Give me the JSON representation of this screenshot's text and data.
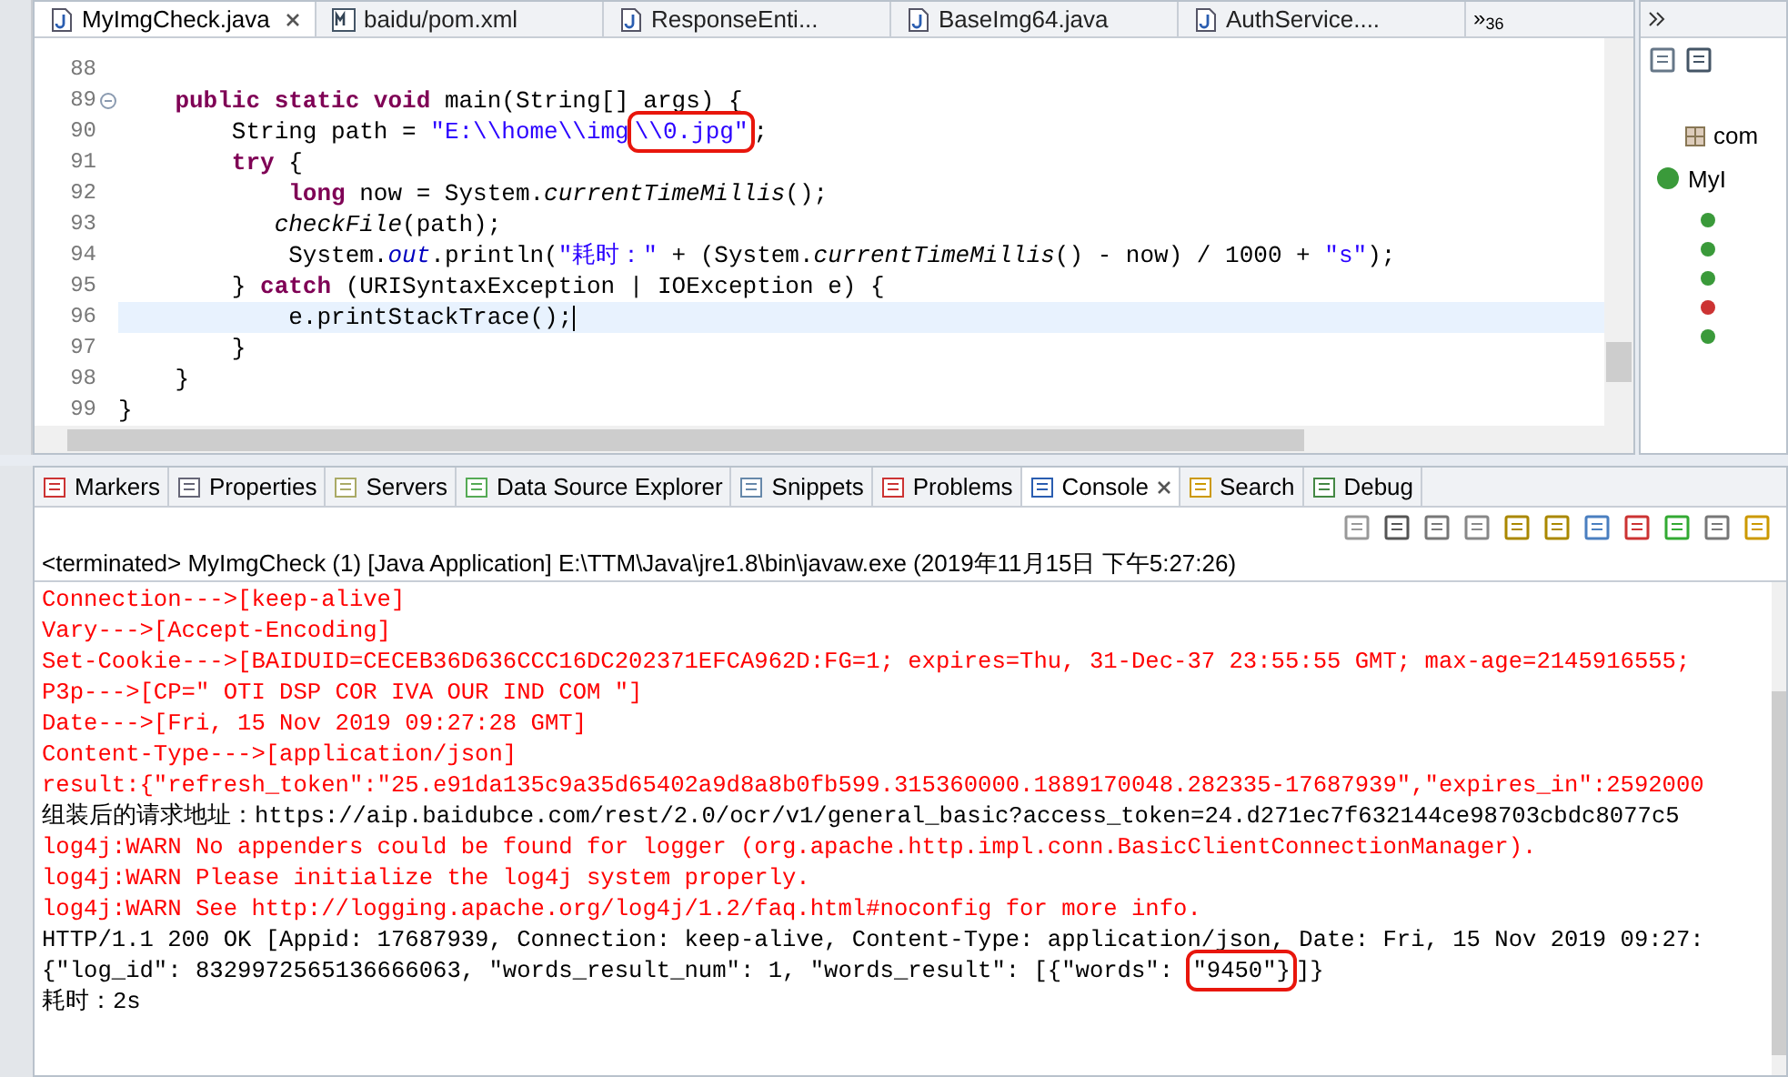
{
  "editor_tabs": [
    {
      "label": "MyImgCheck.java",
      "kind": "java",
      "selected": true
    },
    {
      "label": "baidu/pom.xml",
      "kind": "maven",
      "selected": false
    },
    {
      "label": "ResponseEnti...",
      "kind": "java",
      "selected": false
    },
    {
      "label": "BaseImg64.java",
      "kind": "java",
      "selected": false
    },
    {
      "label": "AuthService....",
      "kind": "java",
      "selected": false
    }
  ],
  "editor_overflow": {
    "symbol": "»",
    "count": "36"
  },
  "code_lines": [
    {
      "number": "88",
      "current": false,
      "folding": false
    },
    {
      "number": "89",
      "current": false,
      "folding": true,
      "segments": [
        {
          "t": "    public",
          "kind": "kw"
        },
        {
          "t": " static",
          "kind": "kw"
        },
        {
          "t": " void",
          "kind": "kw"
        },
        {
          "t": " main(String[] args) {",
          "kind": "plain"
        }
      ]
    },
    {
      "number": "90",
      "current": false,
      "folding": false,
      "segments": [
        {
          "t": "        String path = ",
          "kind": "plain"
        },
        {
          "t": "\"E:\\\\home\\\\img",
          "kind": "str"
        },
        {
          "t": "\\\\0.jpg\"",
          "kind": "str",
          "boxed": true
        },
        {
          "t": ";",
          "kind": "plain"
        }
      ]
    },
    {
      "number": "91",
      "current": false,
      "folding": false,
      "segments": [
        {
          "t": "        try",
          "kind": "kw"
        },
        {
          "t": " {",
          "kind": "plain"
        }
      ]
    },
    {
      "number": "92",
      "current": false,
      "folding": false,
      "segments": [
        {
          "t": "            long",
          "kind": "kw"
        },
        {
          "t": " now = System.",
          "kind": "plain"
        },
        {
          "t": "currentTimeMillis",
          "kind": "ital"
        },
        {
          "t": "();",
          "kind": "plain"
        }
      ]
    },
    {
      "number": "93",
      "current": false,
      "folding": false,
      "segments": [
        {
          "t": "           checkFile",
          "kind": "ital"
        },
        {
          "t": "(path);",
          "kind": "plain"
        }
      ]
    },
    {
      "number": "94",
      "current": false,
      "folding": false,
      "segments": [
        {
          "t": "            System.",
          "kind": "plain"
        },
        {
          "t": "out",
          "kind": "field"
        },
        {
          "t": ".println(",
          "kind": "plain"
        },
        {
          "t": "\"耗时：\"",
          "kind": "str"
        },
        {
          "t": " + (System.",
          "kind": "plain"
        },
        {
          "t": "currentTimeMillis",
          "kind": "ital"
        },
        {
          "t": "() - now) / 1000 + ",
          "kind": "plain"
        },
        {
          "t": "\"s\"",
          "kind": "str"
        },
        {
          "t": ");",
          "kind": "plain"
        }
      ]
    },
    {
      "number": "95",
      "current": false,
      "folding": false,
      "segments": [
        {
          "t": "        } ",
          "kind": "plain"
        },
        {
          "t": "catch",
          "kind": "kw"
        },
        {
          "t": " (URISyntaxException | IOException e) {",
          "kind": "plain"
        }
      ]
    },
    {
      "number": "96",
      "current": true,
      "folding": false,
      "segments": [
        {
          "t": "            e.printStackTrace();",
          "kind": "plain"
        }
      ]
    },
    {
      "number": "97",
      "current": false,
      "folding": false,
      "segments": [
        {
          "t": "        }",
          "kind": "plain"
        }
      ]
    },
    {
      "number": "98",
      "current": false,
      "folding": false,
      "segments": [
        {
          "t": "    }",
          "kind": "plain"
        }
      ]
    },
    {
      "number": "99",
      "current": false,
      "folding": false,
      "segments": [
        {
          "t": "}",
          "kind": "plain"
        }
      ]
    }
  ],
  "outline": {
    "items": [
      {
        "label": "com",
        "kind": "package"
      },
      {
        "label": "MyI",
        "kind": "class"
      }
    ]
  },
  "view_tabs": [
    {
      "label": "Markers",
      "selected": false
    },
    {
      "label": "Properties",
      "selected": false
    },
    {
      "label": "Servers",
      "selected": false
    },
    {
      "label": "Data Source Explorer",
      "selected": false
    },
    {
      "label": "Snippets",
      "selected": false
    },
    {
      "label": "Problems",
      "selected": false
    },
    {
      "label": "Console",
      "selected": true
    },
    {
      "label": "Search",
      "selected": false
    },
    {
      "label": "Debug",
      "selected": false
    }
  ],
  "console": {
    "header": "<terminated> MyImgCheck (1) [Java Application] E:\\TTM\\Java\\jre1.8\\bin\\javaw.exe (2019年11月15日 下午5:27:26)",
    "lines": [
      {
        "kind": "err",
        "segments": [
          {
            "t": "Connection--->[keep-alive]"
          }
        ]
      },
      {
        "kind": "err",
        "segments": [
          {
            "t": "Vary--->[Accept-Encoding]"
          }
        ]
      },
      {
        "kind": "err",
        "segments": [
          {
            "t": "Set-Cookie--->[BAIDUID=CECEB36D636CCC16DC202371EFCA962D:FG=1; expires=Thu, 31-Dec-37 23:55:55 GMT; max-age=2145916555;"
          }
        ]
      },
      {
        "kind": "err",
        "segments": [
          {
            "t": "P3p--->[CP=\" OTI DSP COR IVA OUR IND COM \"]"
          }
        ]
      },
      {
        "kind": "err",
        "segments": [
          {
            "t": "Date--->[Fri, 15 Nov 2019 09:27:28 GMT]"
          }
        ]
      },
      {
        "kind": "err",
        "segments": [
          {
            "t": "Content-Type--->[application/json]"
          }
        ]
      },
      {
        "kind": "err",
        "segments": [
          {
            "t": "result:{\"refresh_token\":\"25.e91da135c9a35d65402a9d8a8b0fb599.315360000.1889170048.282335-17687939\",\"expires_in\":2592000"
          }
        ]
      },
      {
        "kind": "out",
        "segments": [
          {
            "t": "组装后的请求地址：https://aip.baidubce.com/rest/2.0/ocr/v1/general_basic?access_token=24.d271ec7f632144ce98703cbdc8077c5"
          }
        ]
      },
      {
        "kind": "err",
        "segments": [
          {
            "t": "log4j:WARN No appenders could be found for logger (org.apache.http.impl.conn.BasicClientConnectionManager)."
          }
        ]
      },
      {
        "kind": "err",
        "segments": [
          {
            "t": "log4j:WARN Please initialize the log4j system properly."
          }
        ]
      },
      {
        "kind": "err",
        "segments": [
          {
            "t": "log4j:WARN See http://logging.apache.org/log4j/1.2/faq.html#noconfig for more info."
          }
        ]
      },
      {
        "kind": "out",
        "segments": [
          {
            "t": "HTTP/1.1 200 OK [Appid: 17687939, Connection: keep-alive, Content-Type: application/json, Date: Fri, 15 Nov 2019 09:27:"
          }
        ]
      },
      {
        "kind": "out",
        "segments": [
          {
            "t": "{\"log_id\": 8329972565136666063, \"words_result_num\": 1, \"words_result\": [{\"words\": "
          },
          {
            "t": "\"9450\"}",
            "boxed": true
          },
          {
            "t": "]}"
          }
        ]
      },
      {
        "kind": "out",
        "segments": [
          {
            "t": "耗时：2s"
          }
        ]
      }
    ]
  }
}
